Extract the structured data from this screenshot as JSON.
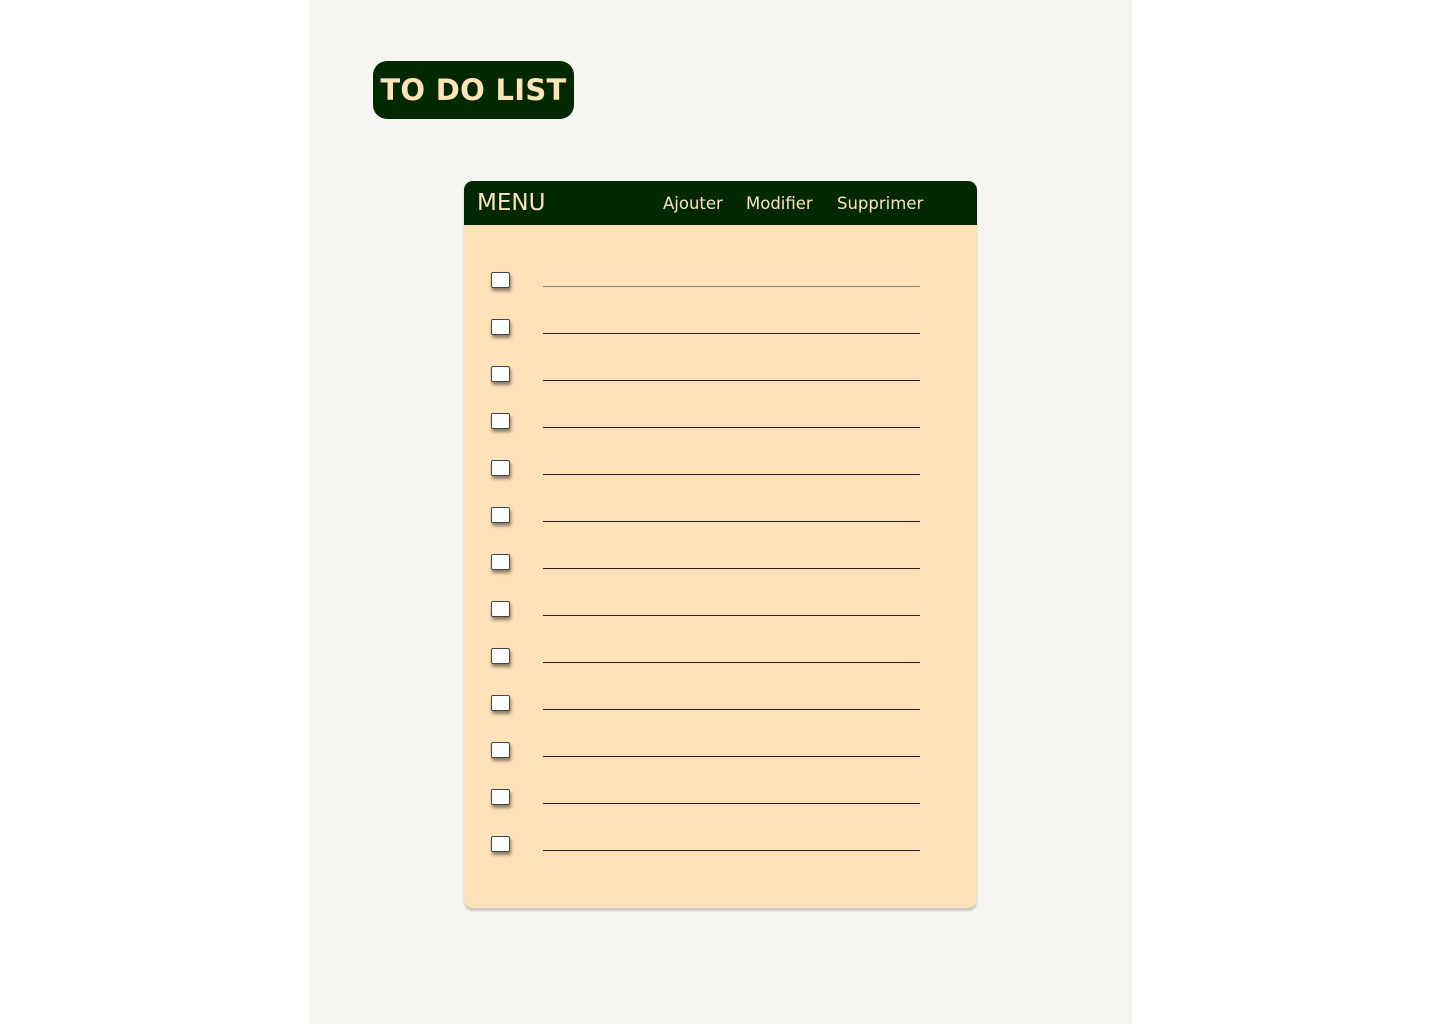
{
  "header": {
    "title": "TO DO LIST"
  },
  "menu": {
    "label": "MENU",
    "actions": {
      "add": "Ajouter",
      "edit": "Modifier",
      "delete": "Supprimer"
    }
  },
  "tasks": {
    "count": 13,
    "items": [
      "",
      "",
      "",
      "",
      "",
      "",
      "",
      "",
      "",
      "",
      "",
      "",
      ""
    ]
  },
  "colors": {
    "page_bg": "#f7f5f1",
    "accent_dark_green": "#022800",
    "cream_text": "#fde3b8",
    "card_bg": "#fde1b9"
  }
}
